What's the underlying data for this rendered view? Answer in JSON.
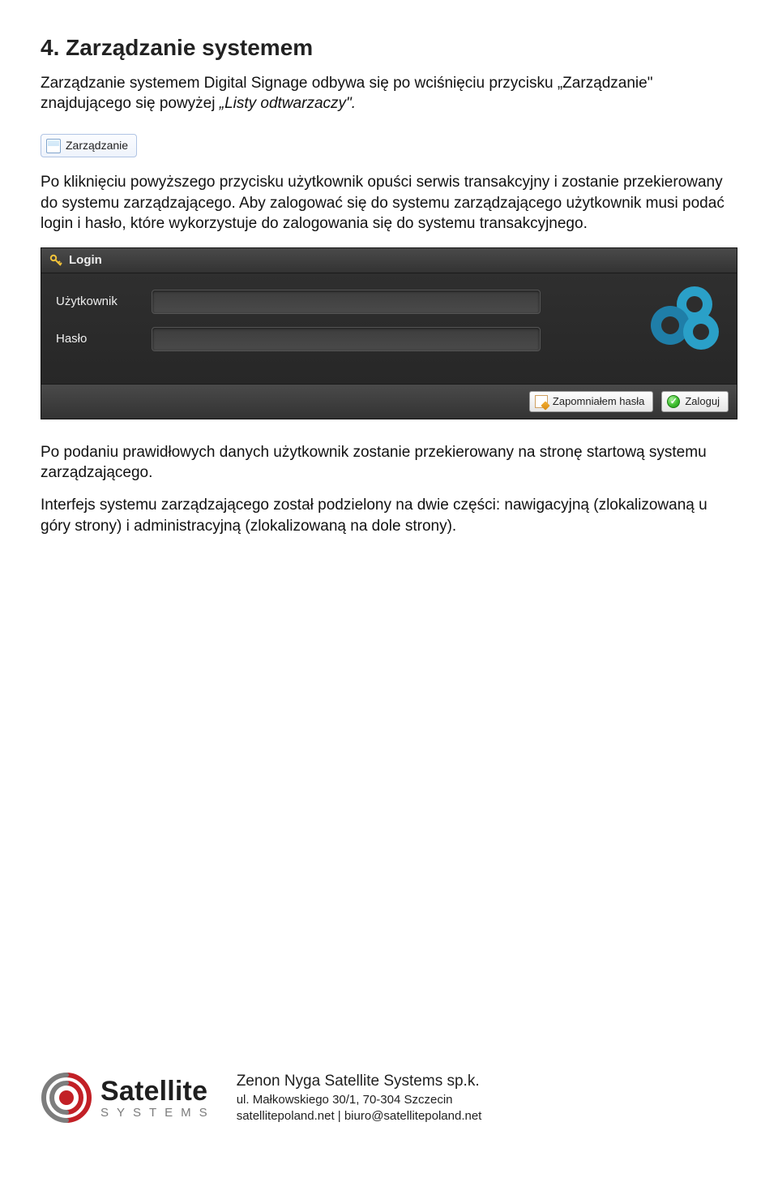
{
  "heading": "4. Zarządzanie systemem",
  "para1_a": "Zarządzanie systemem Digital Signage odbywa się po wciśnięciu przycisku „Zarządzanie\" znajdującego się powyżej ",
  "para1_b": "„Listy odtwarzaczy\".",
  "mgmt_button_label": "Zarządzanie",
  "para2": "Po kliknięciu powyższego przycisku użytkownik opuści serwis transakcyjny i zostanie przekierowany do systemu zarządzającego. Aby zalogować się do systemu zarządzającego użytkownik musi podać login i hasło, które wykorzystuje do zalogowania się do systemu transakcyjnego.",
  "login": {
    "header": "Login",
    "user_label": "Użytkownik",
    "pass_label": "Hasło",
    "forgot": "Zapomniałem hasła",
    "submit": "Zaloguj"
  },
  "para3": "Po podaniu prawidłowych danych użytkownik zostanie przekierowany na stronę startową systemu zarządzającego.",
  "para4": "Interfejs systemu zarządzającego został podzielony na dwie części: nawigacyjną (zlokalizowaną u góry strony) i administracyjną (zlokalizowaną na dole strony).",
  "footer": {
    "brand": "Satellite",
    "systems": "SYSTEMS",
    "company": "Zenon Nyga Satellite Systems sp.k.",
    "addr": "ul. Małkowskiego 30/1, 70-304 Szczecin",
    "contact": "satellitepoland.net | biuro@satellitepoland.net"
  }
}
